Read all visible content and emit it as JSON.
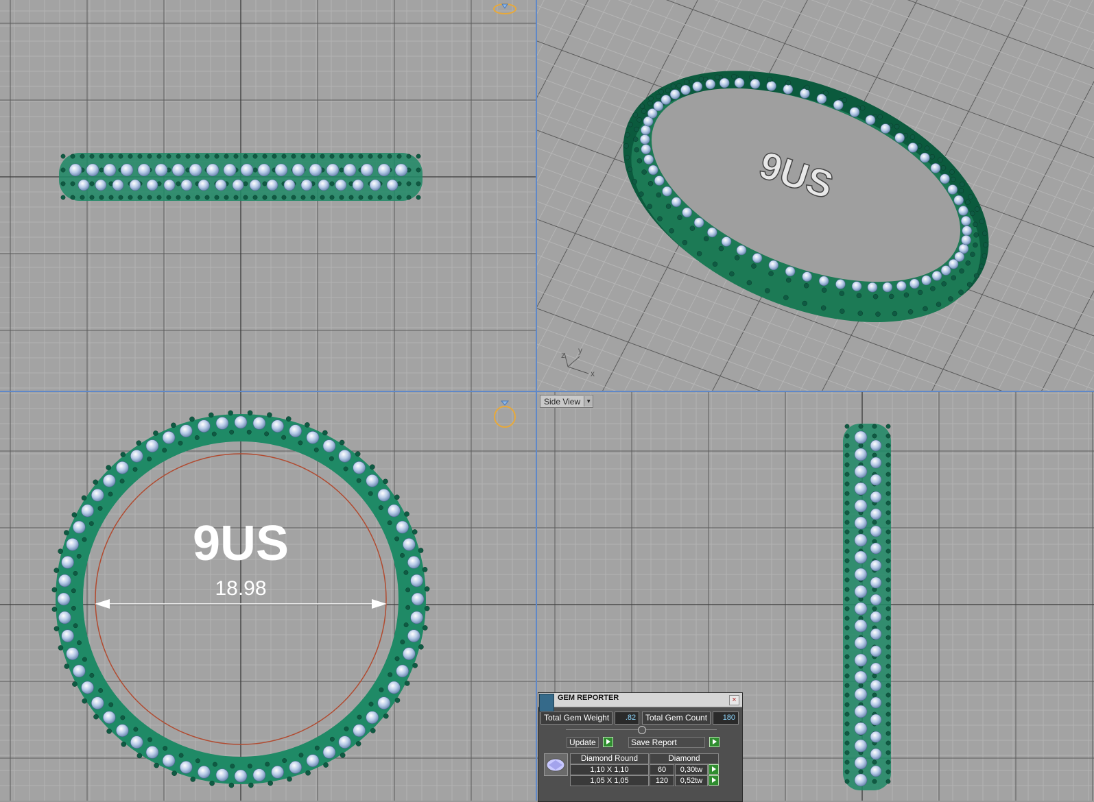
{
  "viewports": {
    "top_view": {
      "name": "top-view"
    },
    "perspective_view": {
      "name": "perspective-view",
      "axes": {
        "x": "x",
        "y": "y",
        "z": "z"
      },
      "engraving": "9US"
    },
    "front_view": {
      "name": "front-view",
      "size_label": "9US",
      "diameter_label": "18.98"
    },
    "side_view": {
      "view_selector": "Side View"
    }
  },
  "gem_reporter": {
    "title": "GEM REPORTER",
    "total_gem_weight_label": "Total Gem Weight",
    "total_gem_weight_value": ".82",
    "total_gem_count_label": "Total Gem Count",
    "total_gem_count_value": "180",
    "update_label": "Update",
    "save_report_label": "Save Report",
    "table": {
      "headers": [
        "Diamond Round",
        "Diamond"
      ],
      "rows": [
        {
          "size": "1,10 X 1,10",
          "count": "60",
          "weight": "0,30tw"
        },
        {
          "size": "1,05 X 1,05",
          "count": "120",
          "weight": "0,52tw"
        }
      ]
    }
  },
  "colors": {
    "metal": "#1f8a66",
    "gem": "#b8cce8",
    "prong": "#0f5a43",
    "grid_bg": "#a3a3a3"
  }
}
